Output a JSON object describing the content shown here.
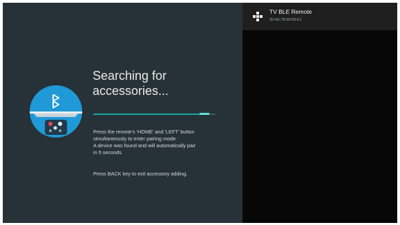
{
  "pairing": {
    "title_line1": "Searching for",
    "title_line2": "accessories...",
    "progress": 0.95,
    "instruction_line1": "Press the remote's 'HOME' and 'LEFT' button",
    "instruction_line2": "simultaneously to enter pairing mode",
    "found_line1": "A device was found and will automatically pair",
    "found_line2": "in 5 seconds",
    "back_hint": "Press BACK key to exit accessory adding.",
    "illustration_icon": "bluetooth-remote-icon"
  },
  "device_list": {
    "items": [
      {
        "icon": "gamepad-icon",
        "name": "TV BLE Remote",
        "address": "30:AE:7B:85:89:E1"
      }
    ]
  },
  "colors": {
    "left_background": "#263238",
    "right_background": "#070707",
    "accent": "#1aa5a3",
    "illustration_blue": "#1f9ad6"
  }
}
